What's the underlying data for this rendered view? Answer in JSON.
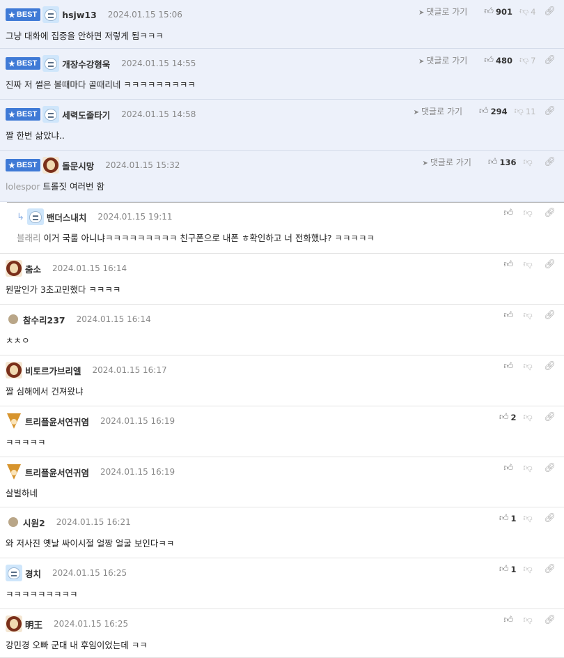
{
  "comments": [
    {
      "best": true,
      "badge": "BEST",
      "avatar": "cat",
      "nick": "hsjw13",
      "date": "2024.01.15 15:06",
      "goto": "댓글로 가기",
      "prefix": "",
      "text": "그냥 대화에 집중을 안하면 저렇게 됨ㅋㅋㅋ",
      "up": "901",
      "down": "4"
    },
    {
      "best": true,
      "badge": "BEST",
      "avatar": "cat",
      "nick": "개장수강형욱",
      "date": "2024.01.15 14:55",
      "goto": "댓글로 가기",
      "prefix": "",
      "text": "진짜 저 썰은 볼때마다 골때리네 ㅋㅋㅋㅋㅋㅋㅋㅋㅋ",
      "up": "480",
      "down": "7"
    },
    {
      "best": true,
      "badge": "BEST",
      "avatar": "cat",
      "nick": "세력도줄타기",
      "date": "2024.01.15 14:58",
      "goto": "댓글로 가기",
      "prefix": "",
      "text": "짤 한번 삶았냐..",
      "up": "294",
      "down": "11"
    },
    {
      "best": true,
      "badge": "BEST",
      "avatar": "lion",
      "nick": "돌문시망",
      "date": "2024.01.15 15:32",
      "goto": "댓글로 가기",
      "prefix": "lolespor",
      "text": "트롤짓 여러번 함",
      "up": "136",
      "down": ""
    },
    {
      "best": false,
      "reply": true,
      "avatar": "cat",
      "nick": "밴더스내치",
      "date": "2024.01.15 19:11",
      "prefix": "블래리",
      "text": "이거 국룰 아니냐ㅋㅋㅋㅋㅋㅋㅋㅋㅋ 친구폰으로 내폰 ㅎ확인하고 너 전화했냐? ㅋㅋㅋㅋㅋ",
      "up": "",
      "down": ""
    },
    {
      "best": false,
      "avatar": "lion",
      "nick": "춤소",
      "date": "2024.01.15 16:14",
      "prefix": "",
      "text": "뭔말인가 3초고민했다 ㅋㅋㅋㅋ",
      "up": "",
      "down": ""
    },
    {
      "best": false,
      "avatar": "dot",
      "nick": "참수리237",
      "date": "2024.01.15 16:14",
      "prefix": "",
      "text": "ㅊㅊㅇ",
      "up": "",
      "down": ""
    },
    {
      "best": false,
      "avatar": "lion",
      "nick": "비토르가브리엘",
      "date": "2024.01.15 16:17",
      "prefix": "",
      "text": "짤 심해에서 건져왔냐",
      "up": "",
      "down": ""
    },
    {
      "best": false,
      "avatar": "fox",
      "nick": "트리플윤서연귀염",
      "date": "2024.01.15 16:19",
      "prefix": "",
      "text": "ㅋㅋㅋㅋㅋ",
      "up": "2",
      "down": ""
    },
    {
      "best": false,
      "avatar": "fox",
      "nick": "트리플윤서연귀염",
      "date": "2024.01.15 16:19",
      "prefix": "",
      "text": "살벌하네",
      "up": "",
      "down": ""
    },
    {
      "best": false,
      "avatar": "dot",
      "nick": "시원2",
      "date": "2024.01.15 16:21",
      "prefix": "",
      "text": "와 저사진 옛날 싸이시절 얼짱 얼굴 보인다ㅋㅋ",
      "up": "1",
      "down": ""
    },
    {
      "best": false,
      "avatar": "cat",
      "nick": "경치",
      "date": "2024.01.15 16:25",
      "prefix": "",
      "text": "ㅋㅋㅋㅋㅋㅋㅋㅋㅋ",
      "up": "1",
      "down": ""
    },
    {
      "best": false,
      "avatar": "lion",
      "nick": "明王",
      "date": "2024.01.15 16:25",
      "prefix": "",
      "text": "강민경 오빠 군대 내 후임이었는데 ㅋㅋ",
      "up": "",
      "down": ""
    }
  ]
}
